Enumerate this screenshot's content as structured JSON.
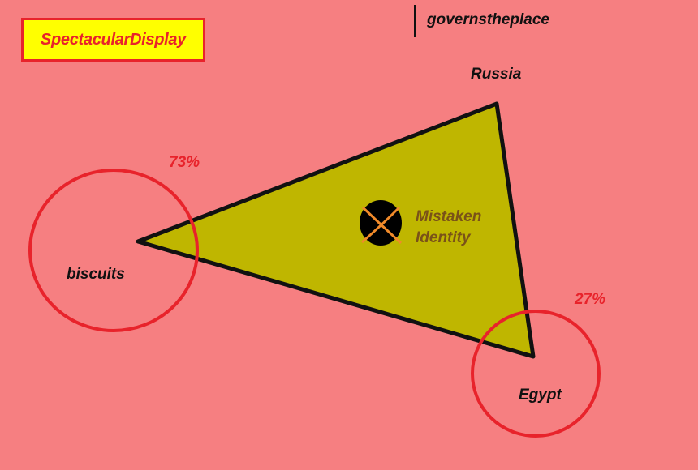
{
  "title": "SpectacularDisplay",
  "caption": "governstheplace",
  "nodes": {
    "top": "Russia",
    "left": "biscuits",
    "bottom_right": "Egypt"
  },
  "percentages": {
    "left": "73%",
    "right": "27%"
  },
  "center_label_line1": "Mistaken",
  "center_label_line2": "Identity",
  "colors": {
    "background": "#f67f81",
    "triangle_fill": "#bfb600",
    "circle_stroke": "#e8232b",
    "title_bg": "#ffff00",
    "title_text": "#e8232b",
    "marker_cross": "#f08a2a",
    "center_label": "#7a5218"
  },
  "icons": {
    "center_marker": "x-marked-dot-icon"
  }
}
